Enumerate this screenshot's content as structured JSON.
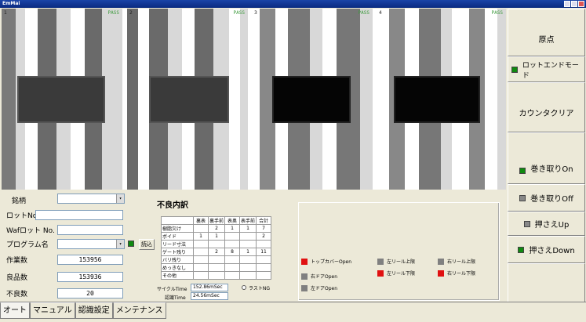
{
  "window": {
    "title": "EmMai"
  },
  "cameras": [
    {
      "label": "1",
      "status": "PASS"
    },
    {
      "label": "2",
      "status": "PASS"
    },
    {
      "label": "3",
      "status": "PASS"
    },
    {
      "label": "4",
      "status": "PASS"
    }
  ],
  "right_panel": {
    "origin": "原点",
    "lot_end_mode": "ロットエンドモード",
    "counter_clear": "カウンタクリア",
    "takeup_on": "巻き取りOn",
    "takeup_off": "巻き取りOff",
    "press_up": "押さえUp",
    "press_down": "押さえDown"
  },
  "form": {
    "brand_label": "銘柄",
    "brand_value": "",
    "lot_label": "ロットNo.",
    "lot_value": "",
    "waf_label": "Wafロット No.",
    "waf_value": "",
    "program_label": "プログラム名",
    "program_value": "",
    "load_button": "読込",
    "work_count_label": "作業数",
    "work_count": "153956",
    "good_count_label": "良品数",
    "good_count": "153936",
    "bad_count_label": "不良数",
    "bad_count": "20"
  },
  "defects": {
    "title": "不良内訳",
    "headers": [
      "",
      "裏表",
      "裏手前",
      "表奥",
      "表手前",
      "合計"
    ],
    "rows": [
      {
        "name": "樹脂欠け",
        "cells": [
          "",
          "2",
          "1",
          "1",
          "7"
        ]
      },
      {
        "name": "ボイド",
        "cells": [
          "1",
          "1",
          "",
          "",
          "2"
        ]
      },
      {
        "name": "リード寸法",
        "cells": [
          "",
          "",
          "",
          "",
          ""
        ]
      },
      {
        "name": "ゲート残り",
        "cells": [
          "",
          "2",
          "8",
          "1",
          "11"
        ]
      },
      {
        "name": "バリ残り",
        "cells": [
          "",
          "",
          "",
          "",
          ""
        ]
      },
      {
        "name": "めっきなし",
        "cells": [
          "",
          "",
          "",
          "",
          ""
        ]
      },
      {
        "name": "その他",
        "cells": [
          "",
          "",
          "",
          "",
          ""
        ]
      }
    ]
  },
  "timing": {
    "cycle_label": "サイクルTime",
    "cycle_value": "152.86mSec",
    "recog_label": "認識Time",
    "recog_value": "24.56mSec",
    "last_ng_label": "ラストNG"
  },
  "status": [
    {
      "label": "トップカバーOpen",
      "color": "#e01010"
    },
    {
      "label": "右ドアOpen",
      "color": "#808080"
    },
    {
      "label": "左ドアOpen",
      "color": "#808080"
    },
    {
      "label": "左リール上限",
      "color": "#808080"
    },
    {
      "label": "左リール下限",
      "color": "#e01010"
    },
    {
      "label": "右リール上限",
      "color": "#808080"
    },
    {
      "label": "右リール下限",
      "color": "#e01010"
    }
  ],
  "indicator_colors": {
    "green": "#108a10",
    "gray": "#888888"
  },
  "tabs": [
    "オート",
    "マニュアル",
    "認識設定",
    "メンテナンス"
  ]
}
